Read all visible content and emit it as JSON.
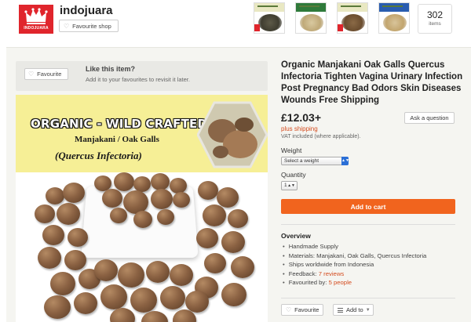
{
  "shop": {
    "name": "indojuara",
    "logo_text": "INDOJUARA",
    "favourite_label": "Favourite shop",
    "items_count": "302",
    "items_label": "items"
  },
  "favourite_banner": {
    "button_label": "Favourite",
    "title": "Like this item?",
    "subtitle": "Add it to your favourites to revisit it later."
  },
  "product_image": {
    "headline": "ORGANIC - WILD CRAFTED",
    "line1": "Manjakani / Oak Galls",
    "line2": "(Quercus Infectoria)"
  },
  "product": {
    "title": "Organic Manjakani Oak Galls Quercus Infectoria Tighten Vagina Urinary Infection Post Pregnancy Bad Odors Skin Diseases Wounds Free Shipping",
    "price": "£12.03+",
    "shipping": "plus shipping",
    "vat": "VAT included (where applicable).",
    "ask_label": "Ask a question",
    "weight_label": "Weight",
    "weight_value": "Select a weight",
    "quantity_label": "Quantity",
    "quantity_value": "1",
    "add_to_cart": "Add to cart"
  },
  "overview": {
    "heading": "Overview",
    "items": [
      "Handmade Supply",
      "Materials: Manjakani, Oak Galls, Quercus Infectoria",
      "Ships worldwide from Indonesia"
    ],
    "feedback_prefix": "Feedback: ",
    "feedback_link": "7 reviews",
    "favourited_prefix": "Favourited by: ",
    "favourited_link": "5 people"
  },
  "actions": {
    "favourite_label": "Favourite",
    "add_to_label": "Add to"
  },
  "colors": {
    "brand_red": "#e0252c",
    "cart_orange": "#f1641e",
    "link_orange": "#d44c1f",
    "banner_yellow": "#f6ef96"
  }
}
